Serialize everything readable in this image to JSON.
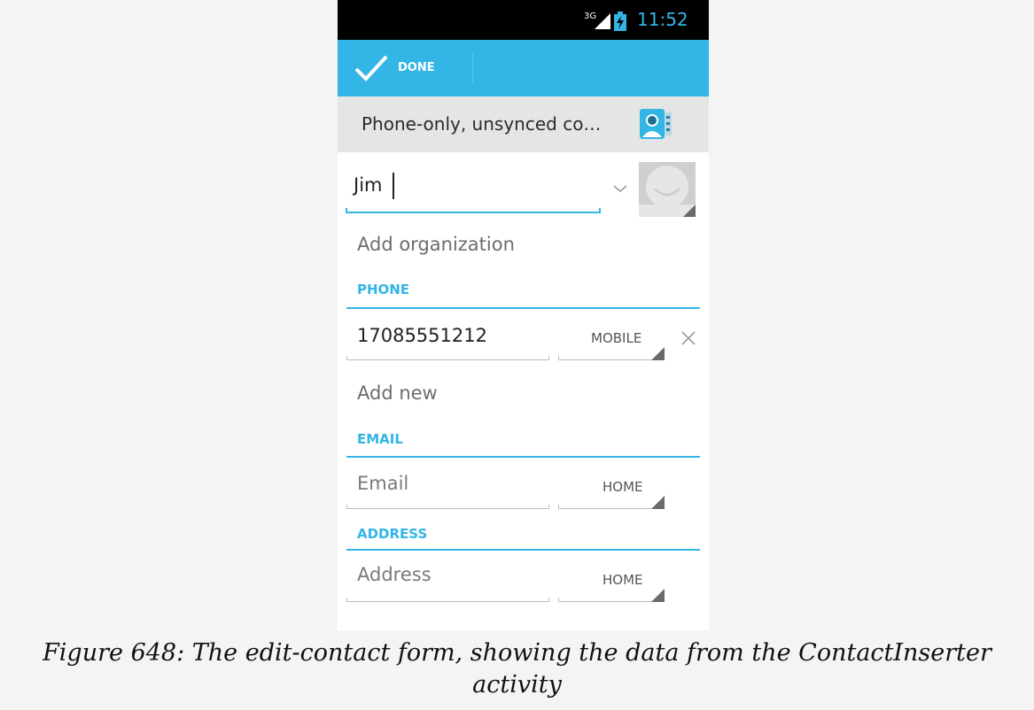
{
  "status_bar": {
    "network": "3G",
    "time": "11:52",
    "icons": [
      "signal-icon",
      "battery-charging-icon"
    ]
  },
  "action_bar": {
    "done_label": "DONE",
    "done_icon": "check-icon"
  },
  "account": {
    "label": "Phone-only, unsynced co…",
    "icon": "contacts-icon"
  },
  "name": {
    "value": "Jim"
  },
  "organization": {
    "label": "Add organization"
  },
  "phone": {
    "header": "PHONE",
    "value": "17085551212",
    "type": "MOBILE",
    "add_new": "Add new"
  },
  "email": {
    "header": "EMAIL",
    "placeholder": "Email",
    "type": "HOME"
  },
  "address": {
    "header": "ADDRESS",
    "placeholder": "Address",
    "type": "HOME"
  },
  "caption": {
    "line1": "Figure 648: The edit-contact form, showing the data from the ContactInserter",
    "line2": "activity"
  },
  "colors": {
    "accent": "#33b5e5",
    "status_bar": "#000000",
    "account_bar": "#e5e5e5"
  }
}
